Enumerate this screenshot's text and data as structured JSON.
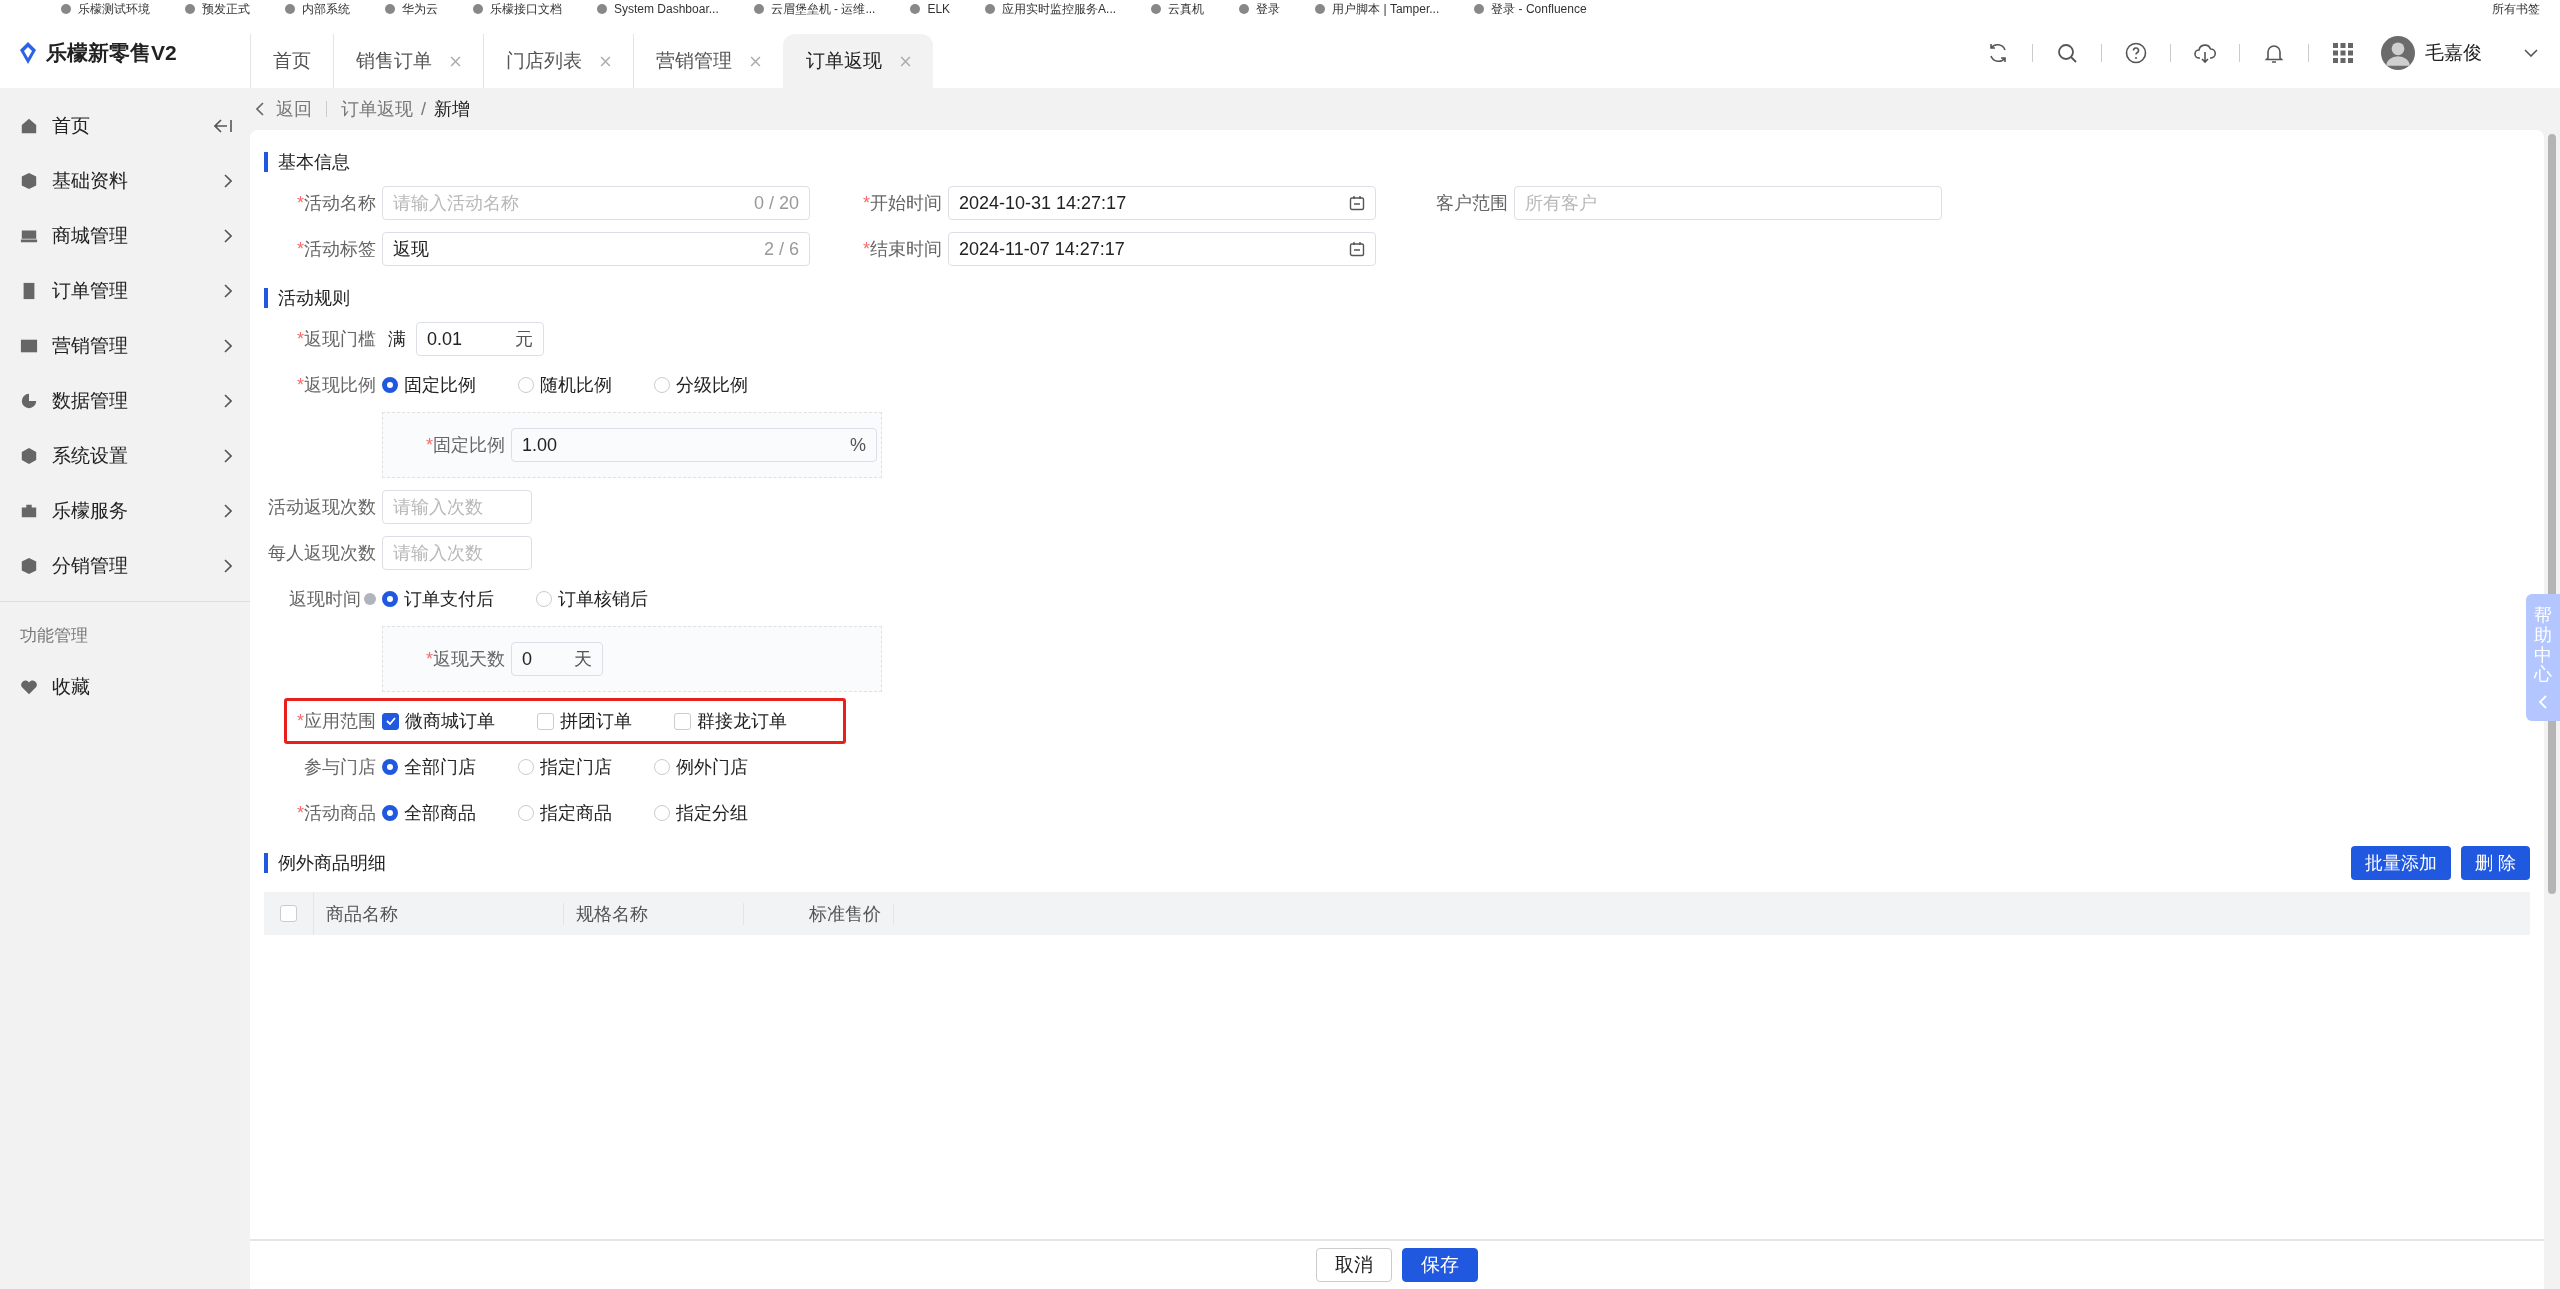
{
  "bookmarks": [
    {
      "label": "乐檬测试环境"
    },
    {
      "label": "预发正式"
    },
    {
      "label": "内部系统"
    },
    {
      "label": "华为云"
    },
    {
      "label": "乐檬接口文档"
    },
    {
      "label": "System Dashboar..."
    },
    {
      "label": "云眉堡垒机 - 运维..."
    },
    {
      "label": "ELK"
    },
    {
      "label": "应用实时监控服务A..."
    },
    {
      "label": "云真机"
    },
    {
      "label": "登录"
    },
    {
      "label": "用户脚本 | Tamper..."
    },
    {
      "label": "登录 - Confluence"
    }
  ],
  "all_bookmarks": "所有书签",
  "required_mark": "*",
  "header": {
    "logo": "乐檬新零售V2",
    "tabs": [
      {
        "label": "首页",
        "closable": false,
        "selected": false
      },
      {
        "label": "销售订单",
        "closable": true,
        "selected": false
      },
      {
        "label": "门店列表",
        "closable": true,
        "selected": false
      },
      {
        "label": "营销管理",
        "closable": true,
        "selected": false
      },
      {
        "label": "订单返现",
        "closable": true,
        "selected": true
      }
    ],
    "user": {
      "name": "毛嘉俊"
    }
  },
  "sidebar": {
    "items": [
      {
        "label": "首页",
        "expandable": false
      },
      {
        "label": "基础资料",
        "expandable": true
      },
      {
        "label": "商城管理",
        "expandable": true
      },
      {
        "label": "订单管理",
        "expandable": true
      },
      {
        "label": "营销管理",
        "expandable": true
      },
      {
        "label": "数据管理",
        "expandable": true
      },
      {
        "label": "系统设置",
        "expandable": true
      },
      {
        "label": "乐檬服务",
        "expandable": true
      },
      {
        "label": "分销管理",
        "expandable": true
      }
    ],
    "section_title": "功能管理",
    "favorites": [
      {
        "label": "收藏"
      }
    ]
  },
  "breadcrumb": {
    "back": "返回",
    "path": [
      "订单返现",
      "新增"
    ],
    "separator": "/"
  },
  "basic_info": {
    "title": "基本信息",
    "fields": [
      {
        "kind": "text",
        "label": "活动名称",
        "required": true,
        "placeholder": "请输入活动名称",
        "counter": "0 / 20"
      },
      {
        "kind": "date",
        "label": "开始时间",
        "required": true,
        "value": "2024-10-31 14:27:17"
      },
      {
        "kind": "text",
        "label": "客户范围",
        "required": false,
        "placeholder": "所有客户"
      },
      {
        "kind": "text",
        "label": "活动标签",
        "required": true,
        "value": "返现",
        "counter": "2 / 6"
      },
      {
        "kind": "date",
        "label": "结束时间",
        "required": true,
        "value": "2024-11-07 14:27:17"
      }
    ]
  },
  "rules": {
    "title": "活动规则",
    "rows": [
      {
        "kind": "amount",
        "label": "返现门槛",
        "required": true,
        "prefix": "满",
        "value": "0.01",
        "unit": "元"
      },
      {
        "kind": "radio",
        "label": "返现比例",
        "required": true,
        "options": [
          {
            "label": "固定比例",
            "selected": true
          },
          {
            "label": "随机比例",
            "selected": false
          },
          {
            "label": "分级比例",
            "selected": false
          }
        ],
        "panel": {
          "kind": "ratio",
          "label": "固定比例",
          "required": true,
          "value": "1.00",
          "unit": "%"
        }
      },
      {
        "kind": "input",
        "label": "活动返现次数",
        "required": false,
        "placeholder": "请输入次数"
      },
      {
        "kind": "input",
        "label": "每人返现次数",
        "required": false,
        "placeholder": "请输入次数"
      },
      {
        "kind": "radio",
        "label": "返现时间",
        "required": false,
        "help": true,
        "options": [
          {
            "label": "订单支付后",
            "selected": true
          },
          {
            "label": "订单核销后",
            "selected": false
          }
        ],
        "panel": {
          "kind": "days",
          "label": "返现天数",
          "required": true,
          "value": "0",
          "unit": "天"
        }
      },
      {
        "kind": "checkbox",
        "label": "应用范围",
        "required": true,
        "highlighted": true,
        "options": [
          {
            "label": "微商城订单",
            "checked": true
          },
          {
            "label": "拼团订单",
            "checked": false
          },
          {
            "label": "群接龙订单",
            "checked": false
          }
        ]
      },
      {
        "kind": "radio",
        "label": "参与门店",
        "required": false,
        "options": [
          {
            "label": "全部门店",
            "selected": true
          },
          {
            "label": "指定门店",
            "selected": false
          },
          {
            "label": "例外门店",
            "selected": false
          }
        ]
      },
      {
        "kind": "radio",
        "label": "活动商品",
        "required": true,
        "options": [
          {
            "label": "全部商品",
            "selected": true
          },
          {
            "label": "指定商品",
            "selected": false
          },
          {
            "label": "指定分组",
            "selected": false
          }
        ]
      }
    ]
  },
  "exceptions": {
    "title": "例外商品明细",
    "actions": [
      {
        "label": "批量添加"
      },
      {
        "label": "删 除"
      }
    ],
    "table": {
      "checked": false,
      "columns": [
        "商品名称",
        "规格名称",
        "标准售价"
      ]
    }
  },
  "footer": {
    "buttons": [
      {
        "kind": "default",
        "label": "取消"
      },
      {
        "kind": "primary",
        "label": "保存"
      }
    ]
  },
  "help_tab": {
    "label": "帮助中心"
  }
}
